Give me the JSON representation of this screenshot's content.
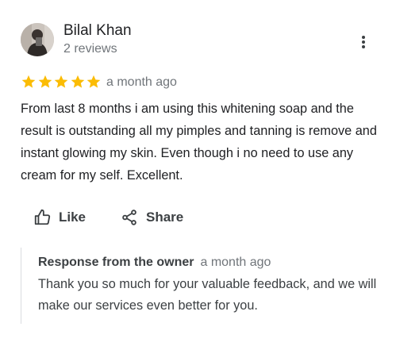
{
  "review": {
    "author": {
      "name": "Bilal Khan",
      "meta": "2 reviews"
    },
    "rating": 5,
    "rating_max": 5,
    "star_color": "#fbbc04",
    "date": "a month ago",
    "text": "From last 8 months i am using this whitening soap and the result is outstanding all my pimples and tanning is remove and instant glowing my skin. Even though i no need to use any cream for my self. Excellent."
  },
  "actions": {
    "like_label": "Like",
    "share_label": "Share"
  },
  "owner_response": {
    "label": "Response from the owner",
    "date": "a month ago",
    "text": "Thank you so much for your valuable feedback, and we will make our services even better for you."
  }
}
